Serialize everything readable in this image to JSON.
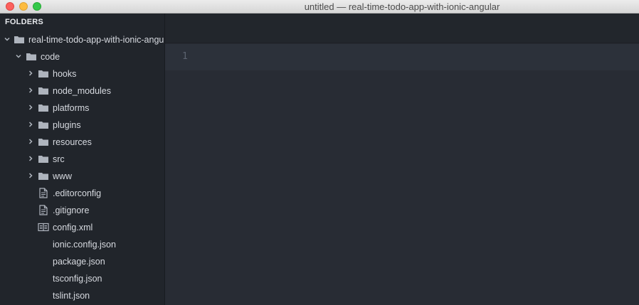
{
  "window": {
    "title": "untitled — real-time-todo-app-with-ionic-angular"
  },
  "sidebar": {
    "header": "FOLDERS",
    "tree": [
      {
        "label": "real-time-todo-app-with-ionic-angular",
        "type": "folder",
        "expanded": true
      },
      {
        "label": "code",
        "type": "folder",
        "expanded": true
      },
      {
        "label": "hooks",
        "type": "folder",
        "expanded": false
      },
      {
        "label": "node_modules",
        "type": "folder",
        "expanded": false
      },
      {
        "label": "platforms",
        "type": "folder",
        "expanded": false
      },
      {
        "label": "plugins",
        "type": "folder",
        "expanded": false
      },
      {
        "label": "resources",
        "type": "folder",
        "expanded": false
      },
      {
        "label": "src",
        "type": "folder",
        "expanded": false
      },
      {
        "label": "www",
        "type": "folder",
        "expanded": false
      },
      {
        "label": ".editorconfig",
        "type": "file",
        "icon": "document-icon"
      },
      {
        "label": ".gitignore",
        "type": "file",
        "icon": "document-icon"
      },
      {
        "label": "config.xml",
        "type": "file",
        "icon": "markup-file-icon"
      },
      {
        "label": "ionic.config.json",
        "type": "file",
        "icon": "none"
      },
      {
        "label": "package.json",
        "type": "file",
        "icon": "none"
      },
      {
        "label": "tsconfig.json",
        "type": "file",
        "icon": "none"
      },
      {
        "label": "tslint.json",
        "type": "file",
        "icon": "none"
      }
    ]
  },
  "editor": {
    "line_numbers": [
      "1"
    ]
  },
  "colors": {
    "sidebar_bg": "#21252b",
    "editor_bg": "#282c34",
    "text": "#d7dae0",
    "line_number": "#5c6370",
    "close": "#fc615d",
    "minimize": "#fdbc40",
    "zoom": "#34c84a"
  }
}
